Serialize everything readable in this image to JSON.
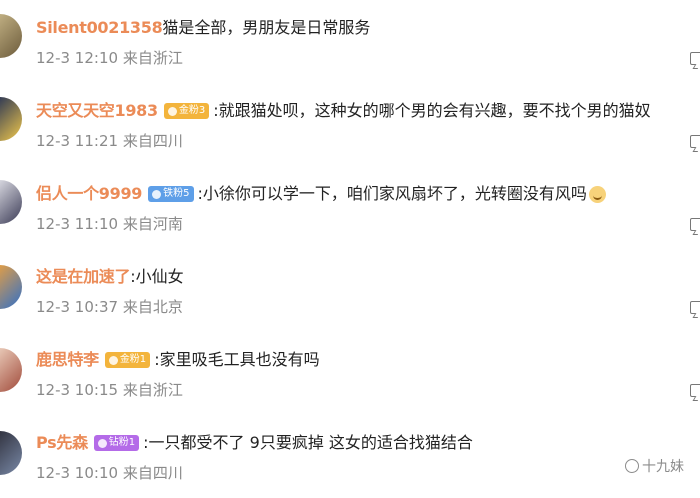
{
  "comments": [
    {
      "username": "Silent0021358",
      "badge": "",
      "text": "猫是全部，男朋友是日常服务",
      "time": "12-3 12:10",
      "location": "来自浙江"
    },
    {
      "username": "天空又天空1983",
      "badge": "金粉3",
      "text": ":就跟猫处呗，这种女的哪个男的会有兴趣，要不找个男的猫奴",
      "time": "12-3 11:21",
      "location": "来自四川"
    },
    {
      "username": "侣人一个9999",
      "badge": "铁粉5",
      "text": ":小徐你可以学一下，咱们家风扇坏了，光转圈没有风吗",
      "time": "12-3 11:10",
      "location": "来自河南"
    },
    {
      "username": "这是在加速了",
      "badge": "",
      "text": ":小仙女",
      "time": "12-3 10:37",
      "location": "来自北京"
    },
    {
      "username": "鹿思特李",
      "badge": "金粉1",
      "text": ":家里吸毛工具也没有吗",
      "time": "12-3 10:15",
      "location": "来自浙江"
    },
    {
      "username": "Ps先森",
      "badge": "钻粉1",
      "text": ":一只都受不了 9只要疯掉 这女的适合找猫结合",
      "time": "12-3 10:10",
      "location": "来自四川"
    }
  ],
  "watermark": "十九妹",
  "colors": {
    "username": "#e8773a",
    "meta": "#8a8a8a",
    "badge_gold": "#f3b43c",
    "badge_iron": "#5e9fe8",
    "badge_diamond": "#b46be8"
  }
}
